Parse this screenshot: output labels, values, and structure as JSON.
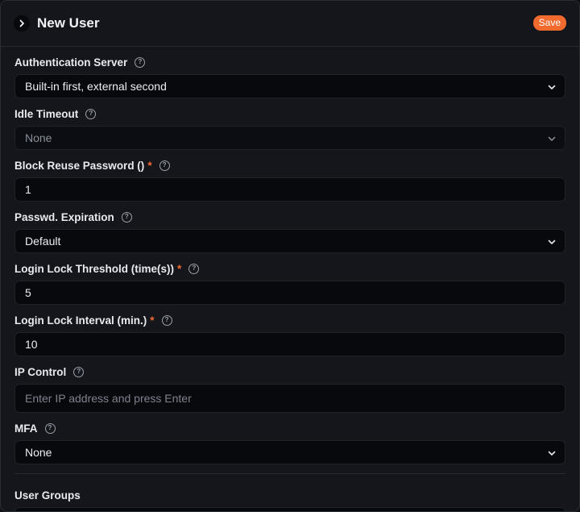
{
  "header": {
    "title": "New User",
    "save_label": "Save",
    "icon": "chevron-right-icon",
    "accent": "#f26a2e"
  },
  "fields": {
    "auth_server": {
      "label": "Authentication Server",
      "value": "Built-in first, external second"
    },
    "idle_timeout": {
      "label": "Idle Timeout",
      "value": "None"
    },
    "block_reuse": {
      "label": "Block Reuse Password ()",
      "required": "*",
      "value": "1"
    },
    "passwd_expiration": {
      "label": "Passwd. Expiration",
      "value": "Default"
    },
    "lock_threshold": {
      "label": "Login Lock Threshold (time(s))",
      "required": "*",
      "value": "5"
    },
    "lock_interval": {
      "label": "Login Lock Interval (min.)",
      "required": "*",
      "value": "10"
    },
    "ip_control": {
      "label": "IP Control",
      "placeholder": "Enter IP address and press Enter"
    },
    "mfa": {
      "label": "MFA",
      "value": "None"
    }
  },
  "user_groups": {
    "label": "User Groups"
  }
}
